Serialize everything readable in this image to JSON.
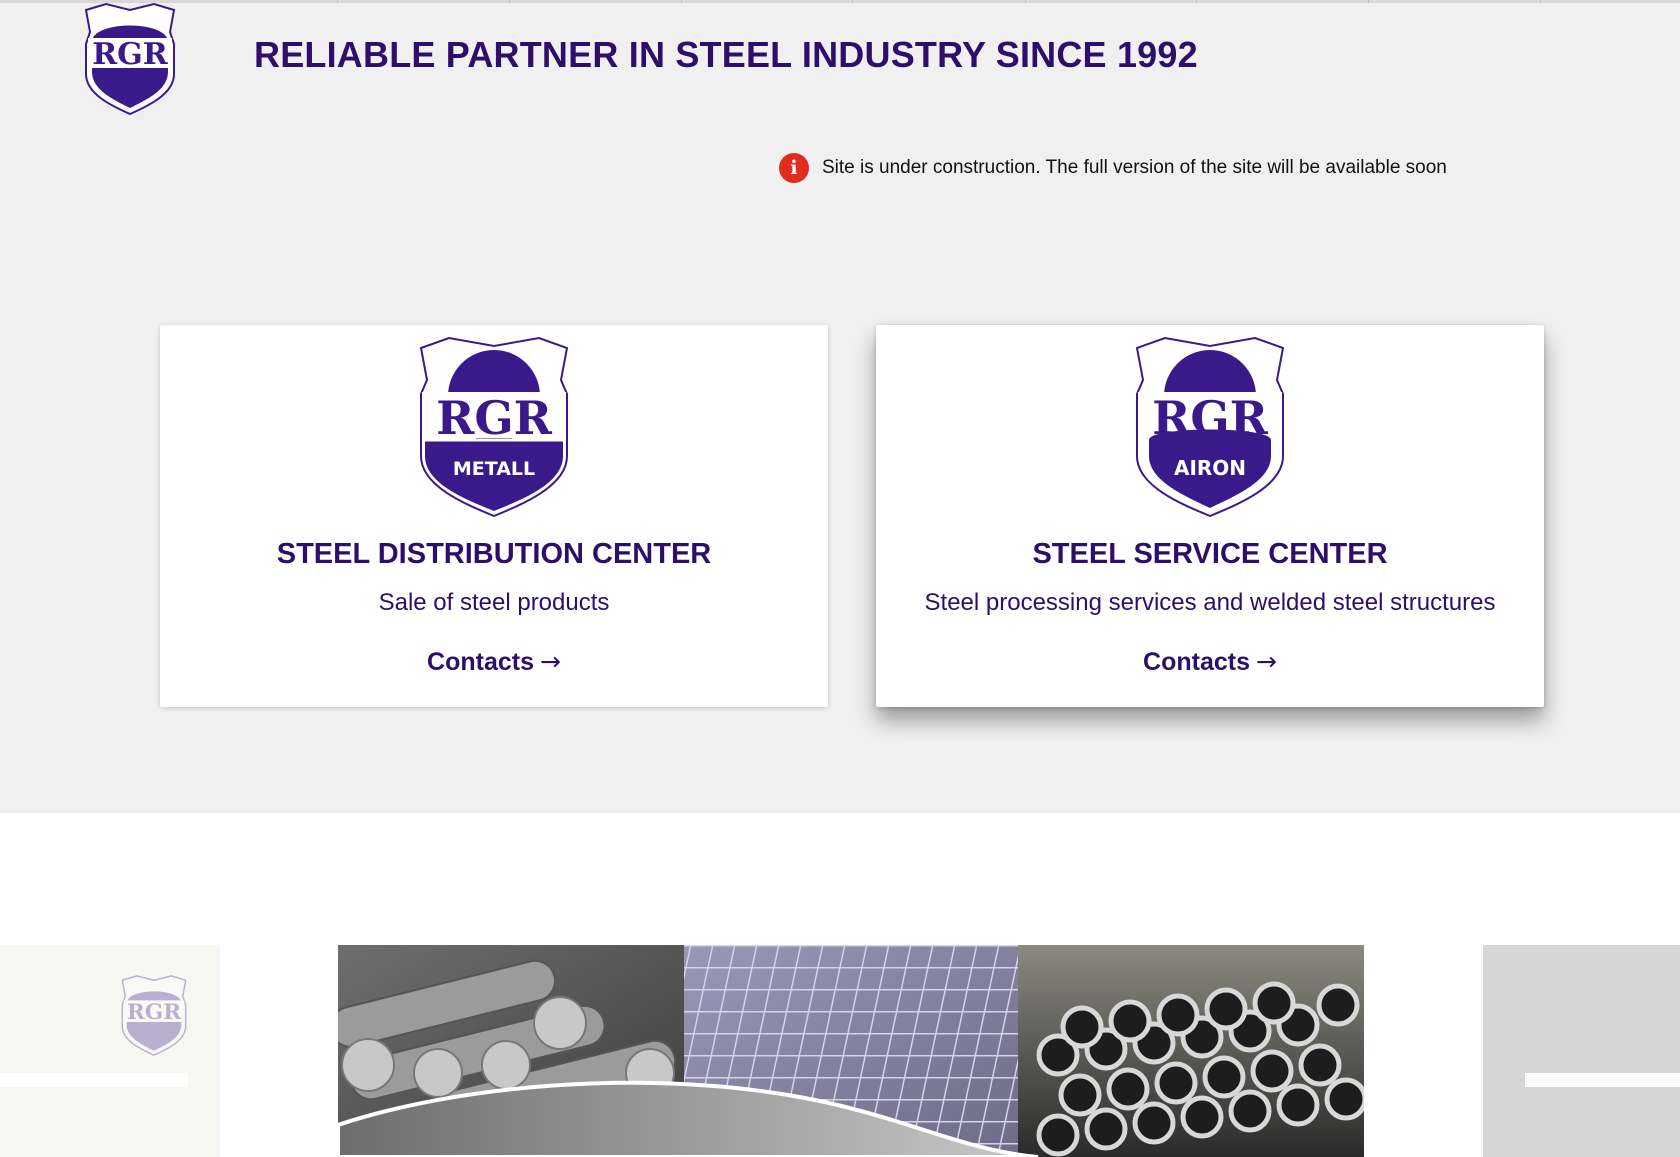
{
  "header": {
    "logo": {
      "icon": "rgr-shield-logo-icon",
      "text": "RGR"
    },
    "headline": "RELIABLE PARTNER IN STEEL INDUSTRY SINCE 1992"
  },
  "notice": {
    "icon": "info-icon",
    "icon_glyph": "i",
    "text": "Site is under construction. The full version of the site will be available soon"
  },
  "cards": [
    {
      "logo": {
        "icon": "rgr-metall-logo-icon",
        "top": "RGR",
        "bottom": "METALL"
      },
      "title": "STEEL DISTRIBUTION CENTER",
      "subtitle": "Sale of steel products",
      "link_label": "Contacts",
      "link_arrow": "→"
    },
    {
      "logo": {
        "icon": "rgr-airon-logo-icon",
        "top": "RGR",
        "bottom": "AIRON"
      },
      "title": "STEEL SERVICE CENTER",
      "subtitle": "Steel processing services and welded steel structures",
      "link_label": "Contacts",
      "link_arrow": "→"
    }
  ],
  "carousel": {
    "left_slide_logo": "RGR",
    "center_slide": [
      "steel-bars-photo",
      "wire-mesh-photo",
      "steel-pipes-photo"
    ]
  },
  "colors": {
    "brand": "#2d0f6b",
    "logo_fill": "#3a1a8a",
    "alert": "#e02d1d",
    "page_bg": "#f0f0f0"
  }
}
